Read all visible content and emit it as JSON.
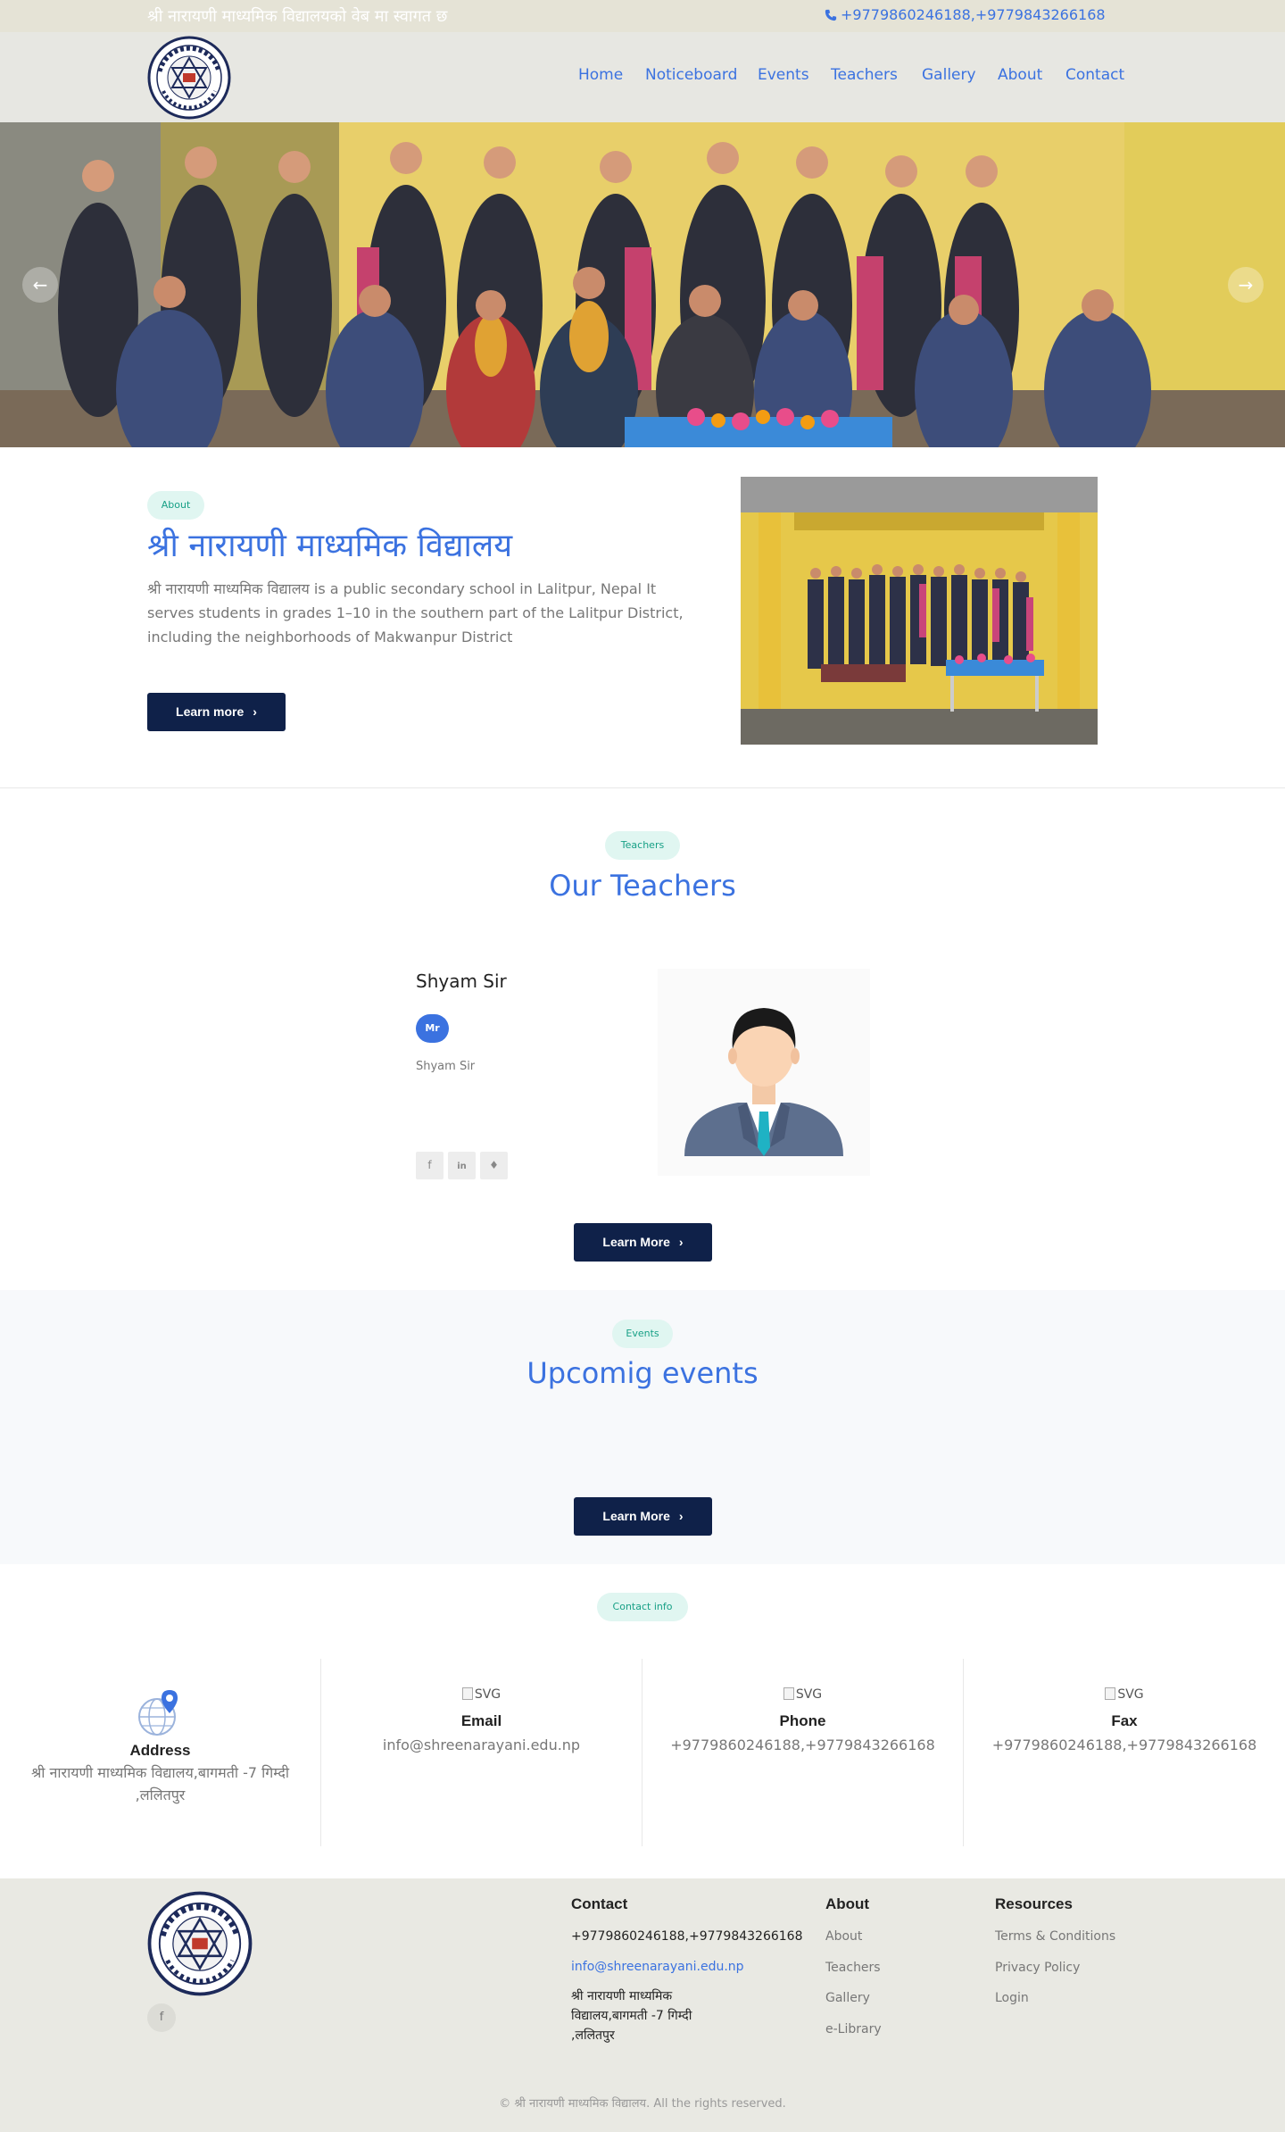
{
  "topbar": {
    "welcome": "श्री नारायणी माध्यमिक विद्यालयको वेब मा स्वागत छ",
    "phone": "+9779860246188,+9779843266168"
  },
  "nav": {
    "items": [
      "Home",
      "Noticeboard",
      "Events",
      "Teachers",
      "Gallery",
      "About",
      "Contact"
    ]
  },
  "hero": {
    "prev_icon": "arrow-left-icon",
    "next_icon": "arrow-right-icon"
  },
  "about": {
    "badge": "About",
    "title": "श्री नारायणी माध्यमिक विद्यालय",
    "text": "श्री नारायणी माध्यमिक विद्यालय is a public secondary school in Lalitpur, Nepal It serves students in grades 1–10 in the southern part of the Lalitpur District, including the neighborhoods of Makwanpur District",
    "button": "Learn more"
  },
  "teachers": {
    "badge": "Teachers",
    "title": "Our Teachers",
    "card": {
      "name": "Shyam Sir",
      "title_badge": "Mr",
      "desc": "Shyam Sir",
      "socials": [
        "facebook-icon",
        "linkedin-icon",
        "twitter-icon"
      ]
    },
    "button": "Learn More"
  },
  "events": {
    "badge": "Events",
    "title": "Upcomig events",
    "button": "Learn More"
  },
  "contact": {
    "badge": "Contact info",
    "columns": [
      {
        "label": "Address",
        "value": "श्री नारायणी माध्यमिक विद्यालय,बागमती -7 गिम्दी ,ललितपुर",
        "icon": "globe-pin-icon"
      },
      {
        "label": "Email",
        "value": "info@shreenarayani.edu.np",
        "icon_alt": "SVG"
      },
      {
        "label": "Phone",
        "value": "+9779860246188,+9779843266168",
        "icon_alt": "SVG"
      },
      {
        "label": "Fax",
        "value": "+9779860246188,+9779843266168",
        "icon_alt": "SVG"
      }
    ]
  },
  "footer": {
    "contact": {
      "heading": "Contact",
      "phone": "+9779860246188,+9779843266168",
      "email": "info@shreenarayani.edu.np",
      "address": "श्री नारायणी माध्यमिक विद्यालय,बागमती -7 गिम्दी ,ललितपुर"
    },
    "about": {
      "heading": "About",
      "links": [
        "About",
        "Teachers",
        "Gallery",
        "e-Library"
      ]
    },
    "resources": {
      "heading": "Resources",
      "links": [
        "Terms & Conditions",
        "Privacy Policy",
        "Login"
      ]
    },
    "copyright": "© श्री नारायणी माध्यमिक विद्यालय. All the rights reserved."
  },
  "colors": {
    "accent": "#3b72e0",
    "dark_button": "#0f2149",
    "badge_bg": "#e0f6f1",
    "badge_text": "#17a086",
    "topbar_bg": "#e5e3d6",
    "header_bg": "#e7e7e2",
    "footer_bg": "#e9e9e3"
  }
}
